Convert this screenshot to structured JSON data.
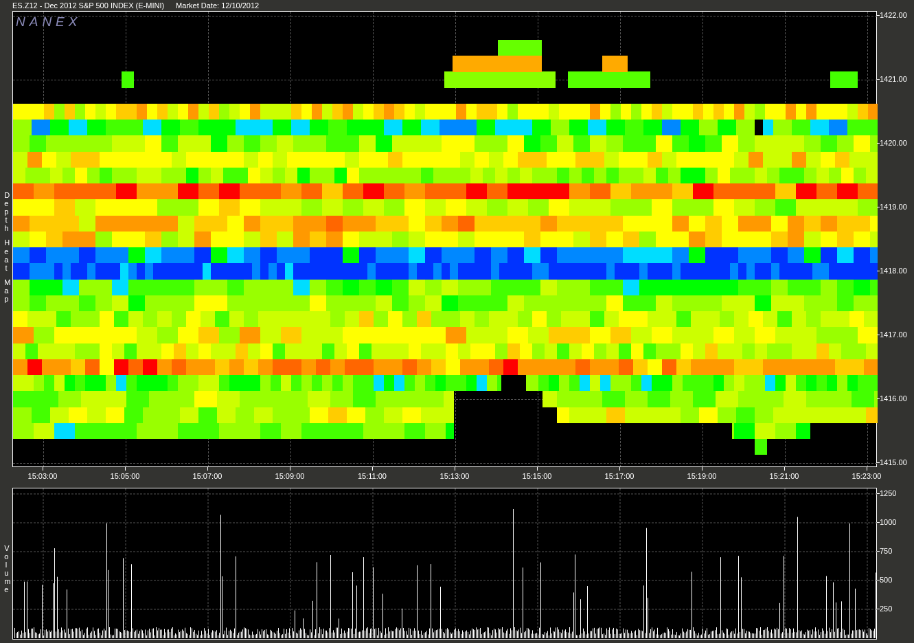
{
  "title_bar": {
    "instrument": "ES.Z12 - Dec 2012 S&P 500 INDEX (E-MINI)",
    "market_date": "Market Date: 12/10/2012"
  },
  "heatmap": {
    "logo": "NANEX",
    "axis_label_words": [
      "Depth",
      "Heat",
      "Map"
    ],
    "price_ticks": [
      "1422.00",
      "1421.00",
      "1420.00",
      "1419.00",
      "1418.00",
      "1417.00",
      "1416.00",
      "1415.00"
    ]
  },
  "time_ticks": [
    "15:03:00",
    "15:05:00",
    "15:07:00",
    "15:09:00",
    "15:11:00",
    "15:13:00",
    "15:15:00",
    "15:17:00",
    "15:19:00",
    "15:21:00",
    "15:23:00"
  ],
  "volume": {
    "axis_label": "Volume",
    "ticks": [
      "1250",
      "1000",
      "750",
      "500",
      "250"
    ]
  }
}
